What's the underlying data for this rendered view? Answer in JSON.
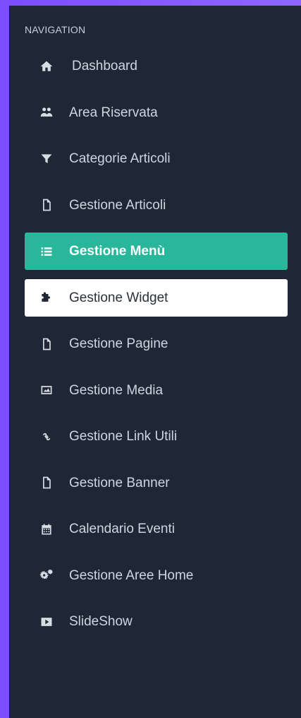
{
  "sidebar": {
    "section_label": "NAVIGATION",
    "items": [
      {
        "label": "Dashboard",
        "icon": "home-icon"
      },
      {
        "label": "Area Riservata",
        "icon": "users-icon"
      },
      {
        "label": "Categorie Articoli",
        "icon": "filter-icon"
      },
      {
        "label": "Gestione Articoli",
        "icon": "file-icon"
      },
      {
        "label": "Gestione Menù",
        "icon": "list-icon",
        "state": "active"
      },
      {
        "label": "Gestione Widget",
        "icon": "puzzle-icon",
        "state": "hover"
      },
      {
        "label": "Gestione Pagine",
        "icon": "file-icon"
      },
      {
        "label": "Gestione Media",
        "icon": "image-icon"
      },
      {
        "label": "Gestione Link Utili",
        "icon": "link-icon"
      },
      {
        "label": "Gestione Banner",
        "icon": "file-icon"
      },
      {
        "label": "Calendario Eventi",
        "icon": "calendar-icon"
      },
      {
        "label": "Gestione Aree Home",
        "icon": "cogs-icon"
      },
      {
        "label": "SlideShow",
        "icon": "play-icon"
      }
    ]
  },
  "colors": {
    "sidebar_bg": "#1f2736",
    "active_bg": "#28b79a",
    "hover_bg": "#ffffff",
    "frame_bg": "#8e66ff"
  }
}
